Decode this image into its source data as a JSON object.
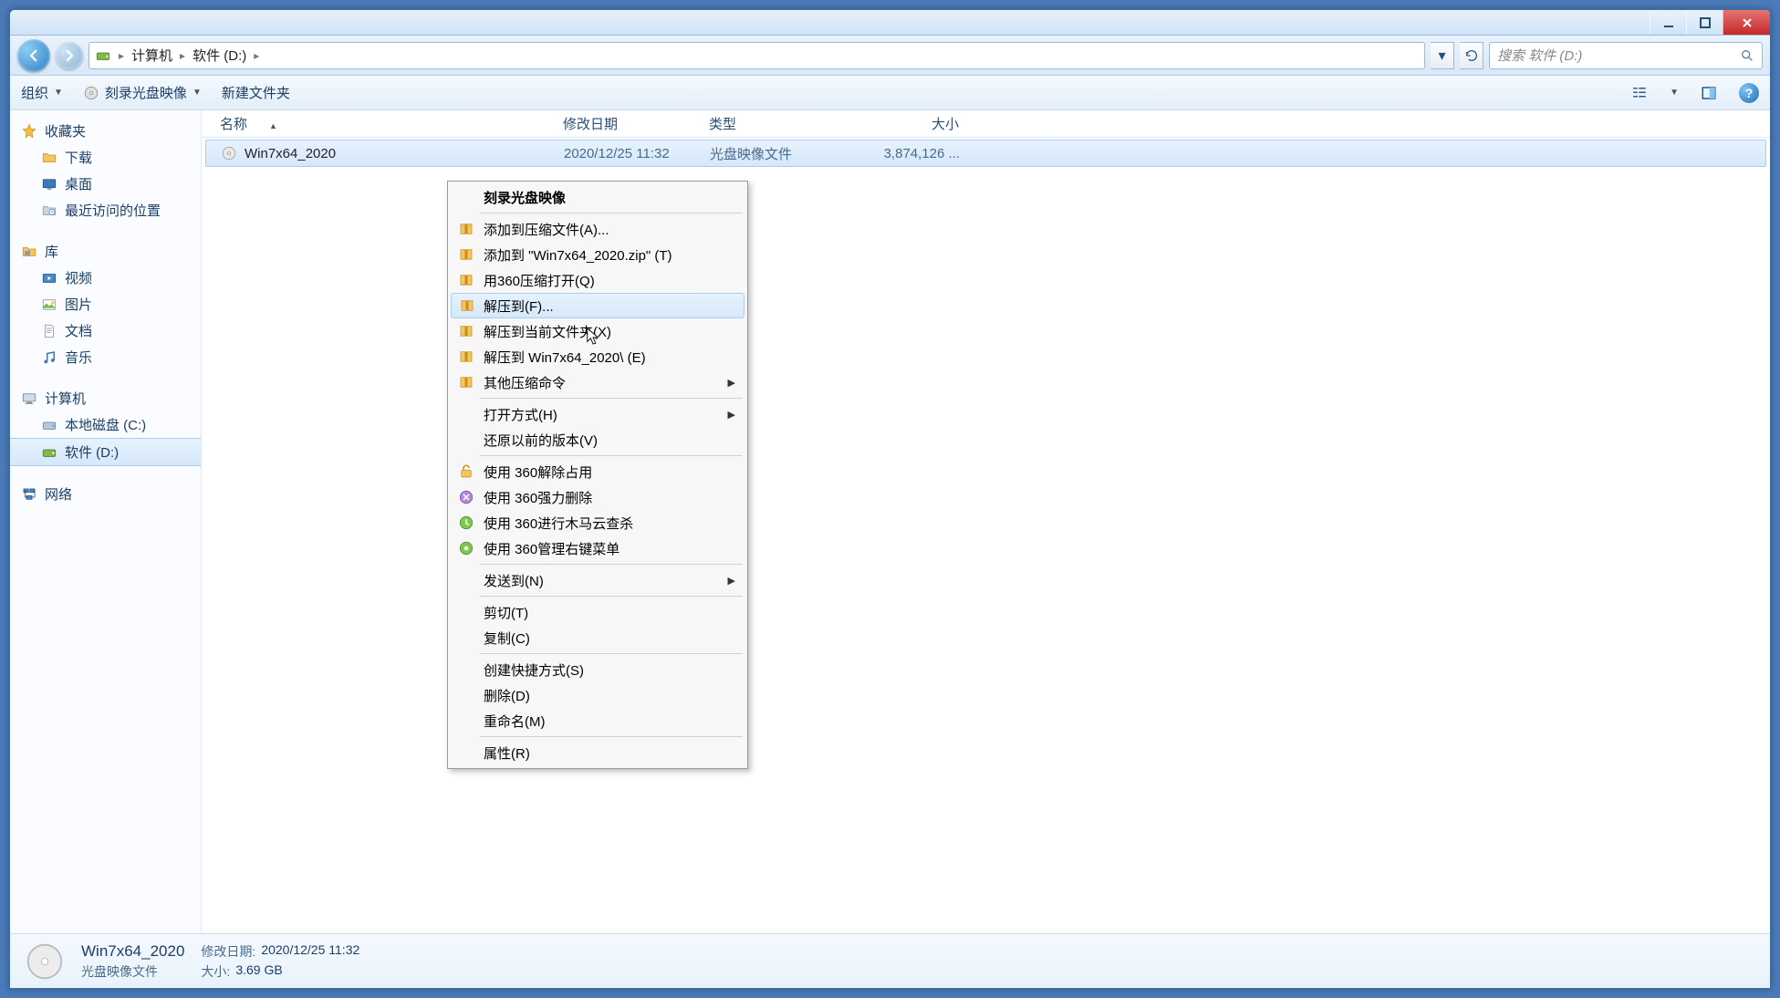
{
  "breadcrumb": {
    "root": "计算机",
    "location": "软件 (D:)"
  },
  "search": {
    "placeholder": "搜索 软件 (D:)"
  },
  "toolbar": {
    "organize": "组织",
    "burn": "刻录光盘映像",
    "new_folder": "新建文件夹"
  },
  "sidebar": {
    "favorites": {
      "label": "收藏夹",
      "items": [
        "下载",
        "桌面",
        "最近访问的位置"
      ]
    },
    "libraries": {
      "label": "库",
      "items": [
        "视频",
        "图片",
        "文档",
        "音乐"
      ]
    },
    "computer": {
      "label": "计算机",
      "items": [
        "本地磁盘 (C:)",
        "软件 (D:)"
      ]
    },
    "network": {
      "label": "网络"
    }
  },
  "columns": {
    "name": "名称",
    "date": "修改日期",
    "type": "类型",
    "size": "大小"
  },
  "files": [
    {
      "name": "Win7x64_2020",
      "date": "2020/12/25 11:32",
      "type": "光盘映像文件",
      "size": "3,874,126 ..."
    }
  ],
  "details": {
    "title": "Win7x64_2020",
    "subtitle": "光盘映像文件",
    "date_label": "修改日期:",
    "date_value": "2020/12/25 11:32",
    "size_label": "大小:",
    "size_value": "3.69 GB"
  },
  "context_menu": {
    "burn": "刻录光盘映像",
    "add_archive": "添加到压缩文件(A)...",
    "add_zip": "添加到 \"Win7x64_2020.zip\" (T)",
    "open_360zip": "用360压缩打开(Q)",
    "extract_to": "解压到(F)...",
    "extract_here": "解压到当前文件夹(X)",
    "extract_named": "解压到 Win7x64_2020\\ (E)",
    "other_zip": "其他压缩命令",
    "open_with": "打开方式(H)",
    "restore_prev": "还原以前的版本(V)",
    "unlock_360": "使用 360解除占用",
    "force_del_360": "使用 360强力删除",
    "scan_360": "使用 360进行木马云查杀",
    "manage_menu_360": "使用 360管理右键菜单",
    "send_to": "发送到(N)",
    "cut": "剪切(T)",
    "copy": "复制(C)",
    "shortcut": "创建快捷方式(S)",
    "delete": "删除(D)",
    "rename": "重命名(M)",
    "properties": "属性(R)"
  }
}
